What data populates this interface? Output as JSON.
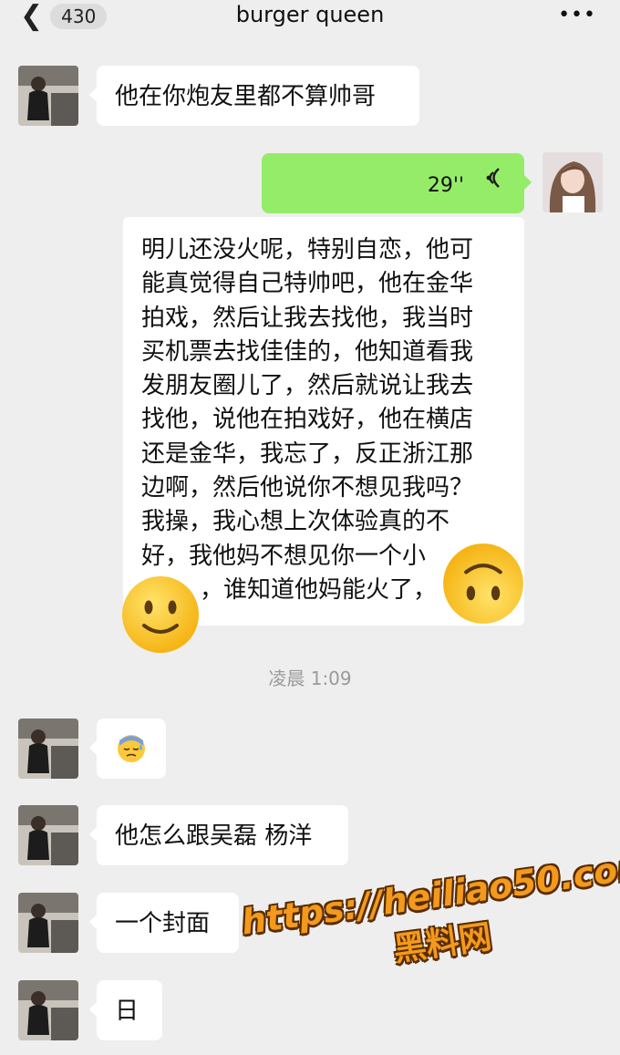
{
  "header": {
    "back_count": "430",
    "title": "burger queen",
    "more_icon": "ellipsis-icon"
  },
  "messages": [
    {
      "side": "left",
      "text": "他在你炮友里都不算帅哥"
    },
    {
      "side": "right",
      "type": "voice",
      "duration": "29''"
    },
    {
      "side": "left",
      "type": "voice-transcript",
      "lines": [
        "明儿还没火呢，特别自恋，他可",
        "能真觉得自己特帅吧，他在金华",
        "拍戏，然后让我去找他，我当时",
        "买机票去找佳佳的，他知道看我",
        "发朋友圈儿了，然后就说让我去",
        "找他，说他在拍戏好，他在横店",
        "还是金华，我忘了，反正浙江那",
        "边啊，然后他说你不想见我吗？",
        "我操，我心想上次体验真的不",
        "好，我他妈不想见你一个小",
        "，谁知道他妈能火了，"
      ]
    },
    {
      "type": "time",
      "text": "凌晨 1:09"
    },
    {
      "side": "left",
      "type": "emoji",
      "emoji": "downcast-sweat-face"
    },
    {
      "side": "left",
      "text": "他怎么跟吴磊 杨洋"
    },
    {
      "side": "left",
      "text": "一个封面"
    },
    {
      "side": "left",
      "text": "日"
    }
  ],
  "watermark": {
    "url": "https://heiliao50.com",
    "name": "黑料网"
  },
  "colors": {
    "background": "#eeeeee",
    "bubble_self": "#95ec69",
    "bubble_other": "#ffffff",
    "watermark": "#f39a1c"
  }
}
